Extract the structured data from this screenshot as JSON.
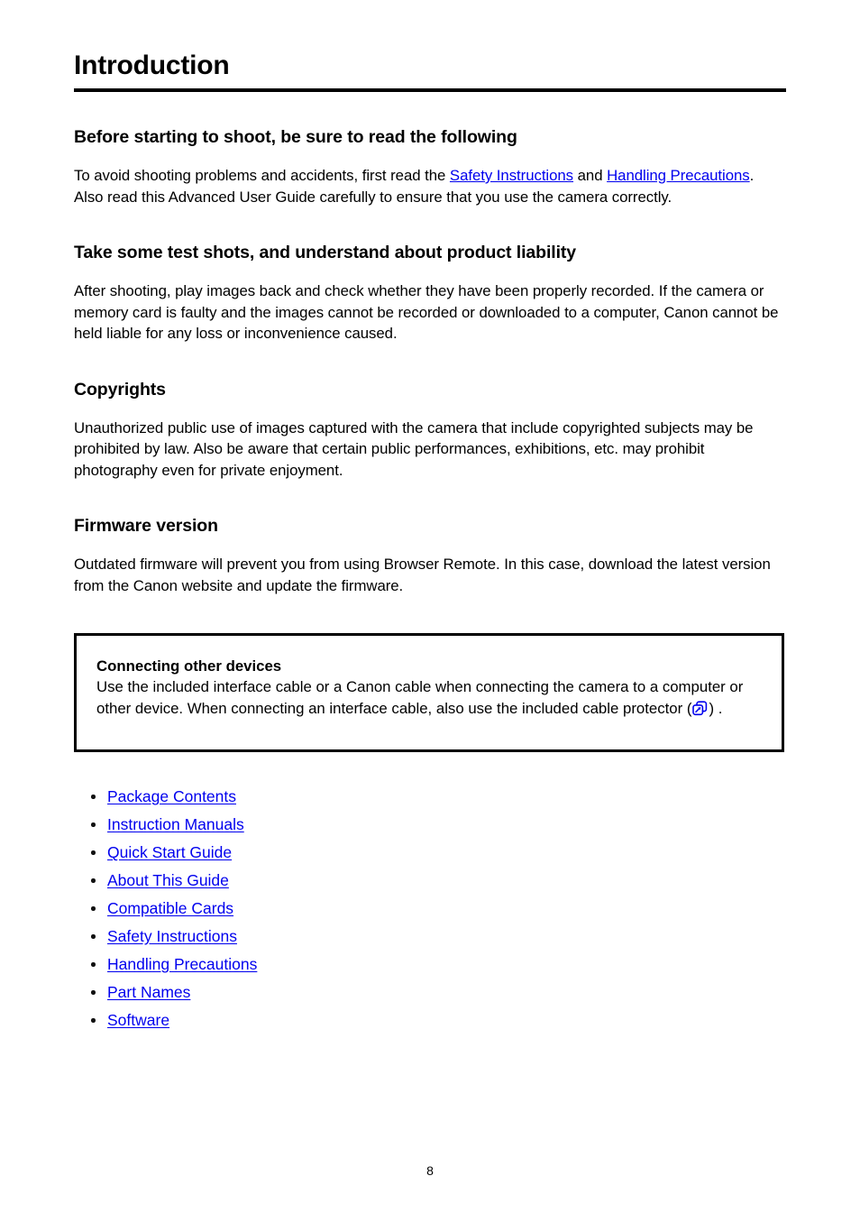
{
  "document": {
    "title": "Introduction",
    "page_number": "8"
  },
  "colors": {
    "link": "#0000ee",
    "text": "#000000",
    "rule": "#000000",
    "box_border": "#000000",
    "icon": "#0000ee"
  },
  "sections": [
    {
      "heading": "Before starting to shoot, be sure to read the following",
      "paragraph": {
        "part1": "To avoid shooting problems and accidents, first read the ",
        "link1": "Safety Instructions",
        "part2": " and ",
        "link2": "Handling Precautions",
        "part3": ". Also read this Advanced User Guide carefully to ensure that you use the camera correctly."
      }
    },
    {
      "heading": "Take some test shots, and understand about product liability",
      "paragraph": "After shooting, play images back and check whether they have been properly recorded. If the camera or memory card is faulty and the images cannot be recorded or downloaded to a computer, Canon cannot be held liable for any loss or inconvenience caused."
    },
    {
      "heading": "Copyrights",
      "paragraph": "Unauthorized public use of images captured with the camera that include copyrighted subjects may be prohibited by law. Also be aware that certain public performances, exhibitions, etc. may prohibit photography even for private enjoyment."
    },
    {
      "heading": "Firmware version",
      "paragraph": "Outdated firmware will prevent you from using Browser Remote. In this case, download the latest version from the Canon website and update the firmware."
    }
  ],
  "callout": {
    "title": "Connecting other devices",
    "body_part1": "Use the included interface cable or a Canon cable when connecting the camera to a computer or other device. When connecting an interface cable, also use the included cable protector (",
    "icon_name": "cross-reference-link-icon",
    "body_part2": ").'"
  },
  "link_list": [
    {
      "label": "Package Contents"
    },
    {
      "label": "Instruction Manuals"
    },
    {
      "label": "Quick Start Guide"
    },
    {
      "label": "About This Guide"
    },
    {
      "label": "Compatible Cards"
    },
    {
      "label": "Safety Instructions"
    },
    {
      "label": "Handling Precautions"
    },
    {
      "label": "Part Names"
    },
    {
      "label": "Software"
    }
  ]
}
